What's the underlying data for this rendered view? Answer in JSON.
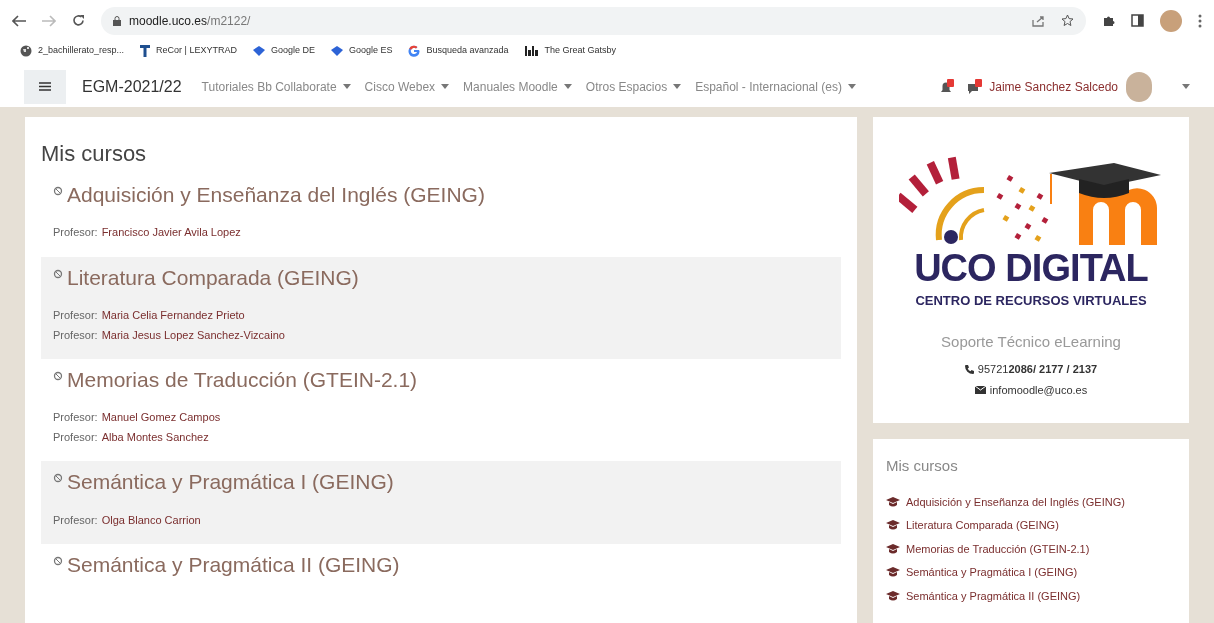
{
  "browser": {
    "url_host": "moodle.uco.es",
    "url_path": "/m2122/",
    "bookmarks": [
      {
        "kind": "globe",
        "label": "2_bachillerato_resp..."
      },
      {
        "kind": "t",
        "label": "ReCor | LEXYTRAD"
      },
      {
        "kind": "diamond",
        "label": "Google DE"
      },
      {
        "kind": "diamond",
        "label": "Google ES"
      },
      {
        "kind": "g",
        "label": "Busqueda avanzada"
      },
      {
        "kind": "bb",
        "label": "The Great Gatsby"
      }
    ]
  },
  "navbar": {
    "site": "EGM-2021/22",
    "menus": [
      "Tutoriales Bb Collaborate",
      "Cisco Webex",
      "Manuales Moodle",
      "Otros Espacios",
      "Español - Internacional (es)"
    ],
    "user": "Jaime Sanchez Salcedo"
  },
  "courses": {
    "title": "Mis cursos",
    "items": [
      {
        "name": "Adquisición y Enseñanza del Inglés (GEING)",
        "teachers": [
          {
            "label": "Profesor:",
            "name": "Francisco Javier Avila Lopez"
          }
        ]
      },
      {
        "name": "Literatura Comparada (GEING)",
        "teachers": [
          {
            "label": "Profesor:",
            "name": "Maria Celia Fernandez Prieto"
          },
          {
            "label": "Profesor:",
            "name": "Maria Jesus Lopez Sanchez-Vizcaino"
          }
        ]
      },
      {
        "name": "Memorias de Traducción (GTEIN-2.1)",
        "teachers": [
          {
            "label": "Profesor:",
            "name": "Manuel Gomez Campos"
          },
          {
            "label": "Profesor:",
            "name": "Alba Montes Sanchez"
          }
        ]
      },
      {
        "name": "Semántica y Pragmática I (GEING)",
        "teachers": [
          {
            "label": "Profesor:",
            "name": "Olga Blanco Carrion"
          }
        ]
      },
      {
        "name": "Semántica y Pragmática II (GEING)"
      }
    ]
  },
  "support": {
    "logo_title": "UCO DIGITAL",
    "logo_subtitle": "CENTRO DE RECURSOS VIRTUALES",
    "heading": "Soporte Técnico eLearning",
    "phone": "95721**2086/ 2177 / 2137**",
    "email": "infomoodle@uco.es"
  },
  "my_courses_block": {
    "title": "Mis cursos",
    "links": [
      "Adquisición y Enseñanza del Inglés (GEING)",
      "Literatura Comparada (GEING)",
      "Memorias de Traducción (GTEIN-2.1)",
      "Semántica y Pragmática I (GEING)",
      "Semántica y Pragmática II (GEING)"
    ]
  }
}
